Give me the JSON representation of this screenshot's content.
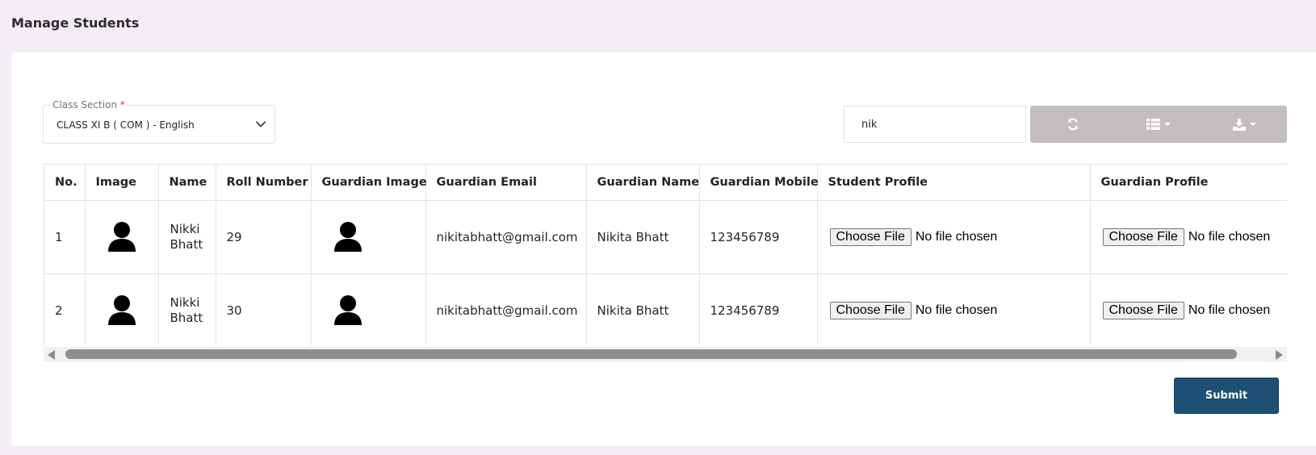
{
  "page": {
    "title": "Manage Students"
  },
  "class_section": {
    "label": "Class Section",
    "required_mark": "*",
    "value": "CLASS XI B ( COM ) - English"
  },
  "search": {
    "value": "nik"
  },
  "toolbar": {
    "icons": [
      "refresh-icon",
      "columns-icon",
      "export-icon"
    ]
  },
  "table": {
    "headers": {
      "no": "No.",
      "image": "Image",
      "name": "Name",
      "roll": "Roll Number",
      "guardian_image": "Guardian Image",
      "guardian_email": "Guardian Email",
      "guardian_name": "Guardian Name",
      "guardian_mobile": "Guardian Mobile",
      "student_profile": "Student Profile",
      "guardian_profile": "Guardian Profile"
    },
    "rows": [
      {
        "no": "1",
        "name_first": "Nikki",
        "name_last": "Bhatt",
        "roll": "29",
        "guardian_email": "nikitabhatt@gmail.com",
        "guardian_name": "Nikita Bhatt",
        "guardian_mobile": "123456789",
        "file_button": "Choose File",
        "file_status": "No file chosen"
      },
      {
        "no": "2",
        "name_first": "Nikki",
        "name_last": "Bhatt",
        "roll": "30",
        "guardian_email": "nikitabhatt@gmail.com",
        "guardian_name": "Nikita Bhatt",
        "guardian_mobile": "123456789",
        "file_button": "Choose File",
        "file_status": "No file chosen"
      }
    ]
  },
  "actions": {
    "submit": "Submit"
  },
  "colors": {
    "page_bg": "#f2eef3",
    "toolbar_bg": "#c3bdbd",
    "submit_bg": "#1e4f74",
    "required": "#dc3545"
  }
}
